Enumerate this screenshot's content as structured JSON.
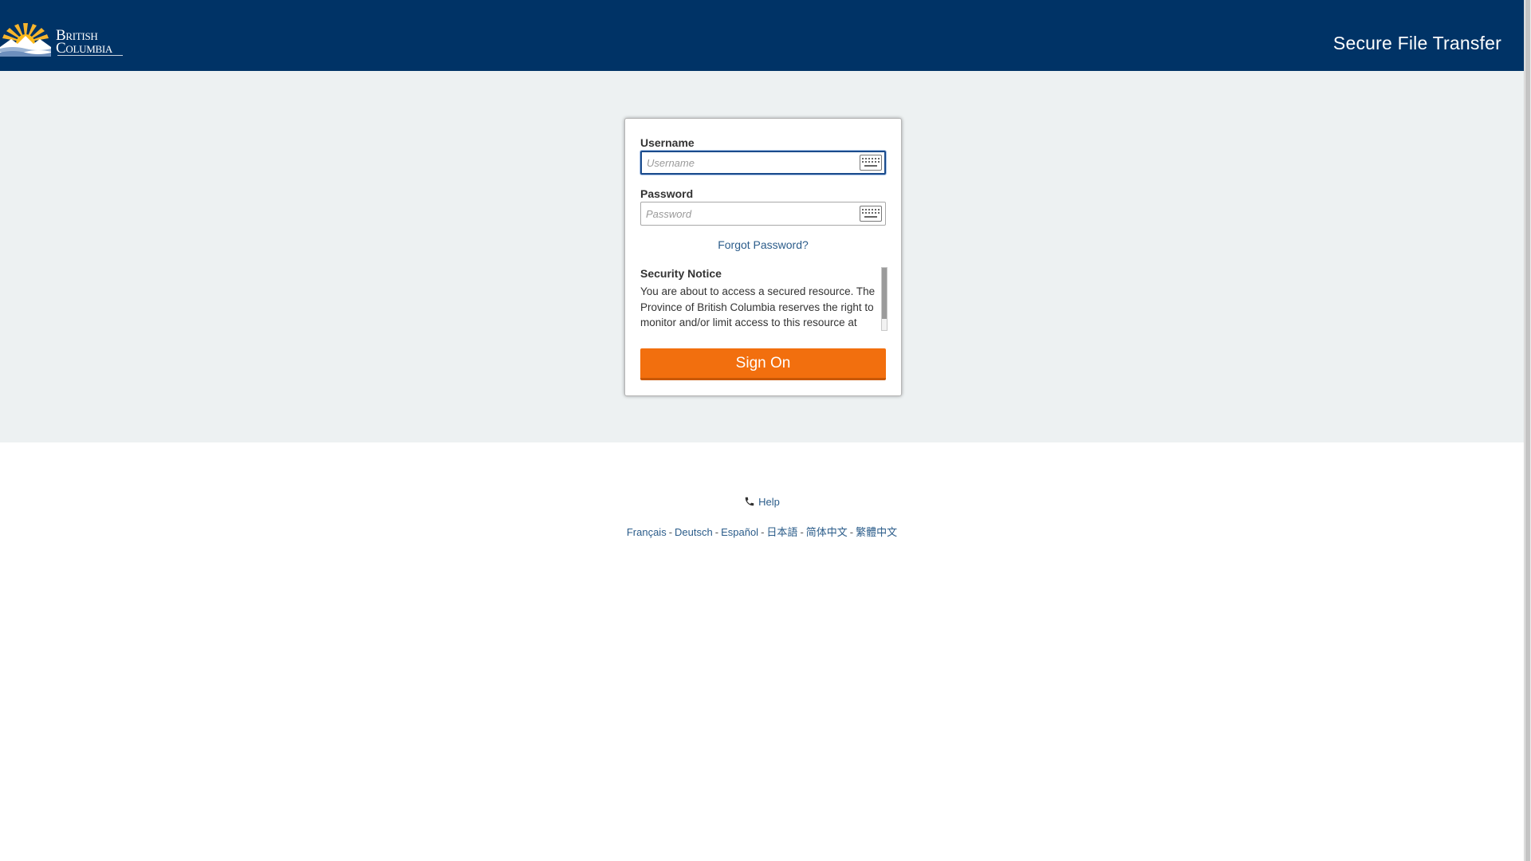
{
  "header": {
    "logo_line1": "British",
    "logo_line2": "Columbia",
    "app_title": "Secure File Transfer"
  },
  "login": {
    "username_label": "Username",
    "username_placeholder": "Username",
    "username_value": "",
    "password_label": "Password",
    "password_placeholder": "Password",
    "password_value": "",
    "keyboard_icon": "keyboard-icon",
    "forgot_label": "Forgot Password?",
    "notice_title": "Security Notice",
    "notice_body": "You are about to access a secured resource. The Province of British Columbia reserves the right to monitor and/or limit access to this resource at",
    "sign_on_label": "Sign On"
  },
  "footer": {
    "help_icon": "phone-icon",
    "help_label": "Help",
    "languages": [
      "Français",
      "Deutsch",
      "Español",
      "日本語",
      "简体中文",
      "繁體中文"
    ],
    "separator": "-"
  },
  "colors": {
    "header_bg": "#003366",
    "band_bg": "#edf1f2",
    "accent": "#f26f0e",
    "link": "#2b5c8a"
  }
}
